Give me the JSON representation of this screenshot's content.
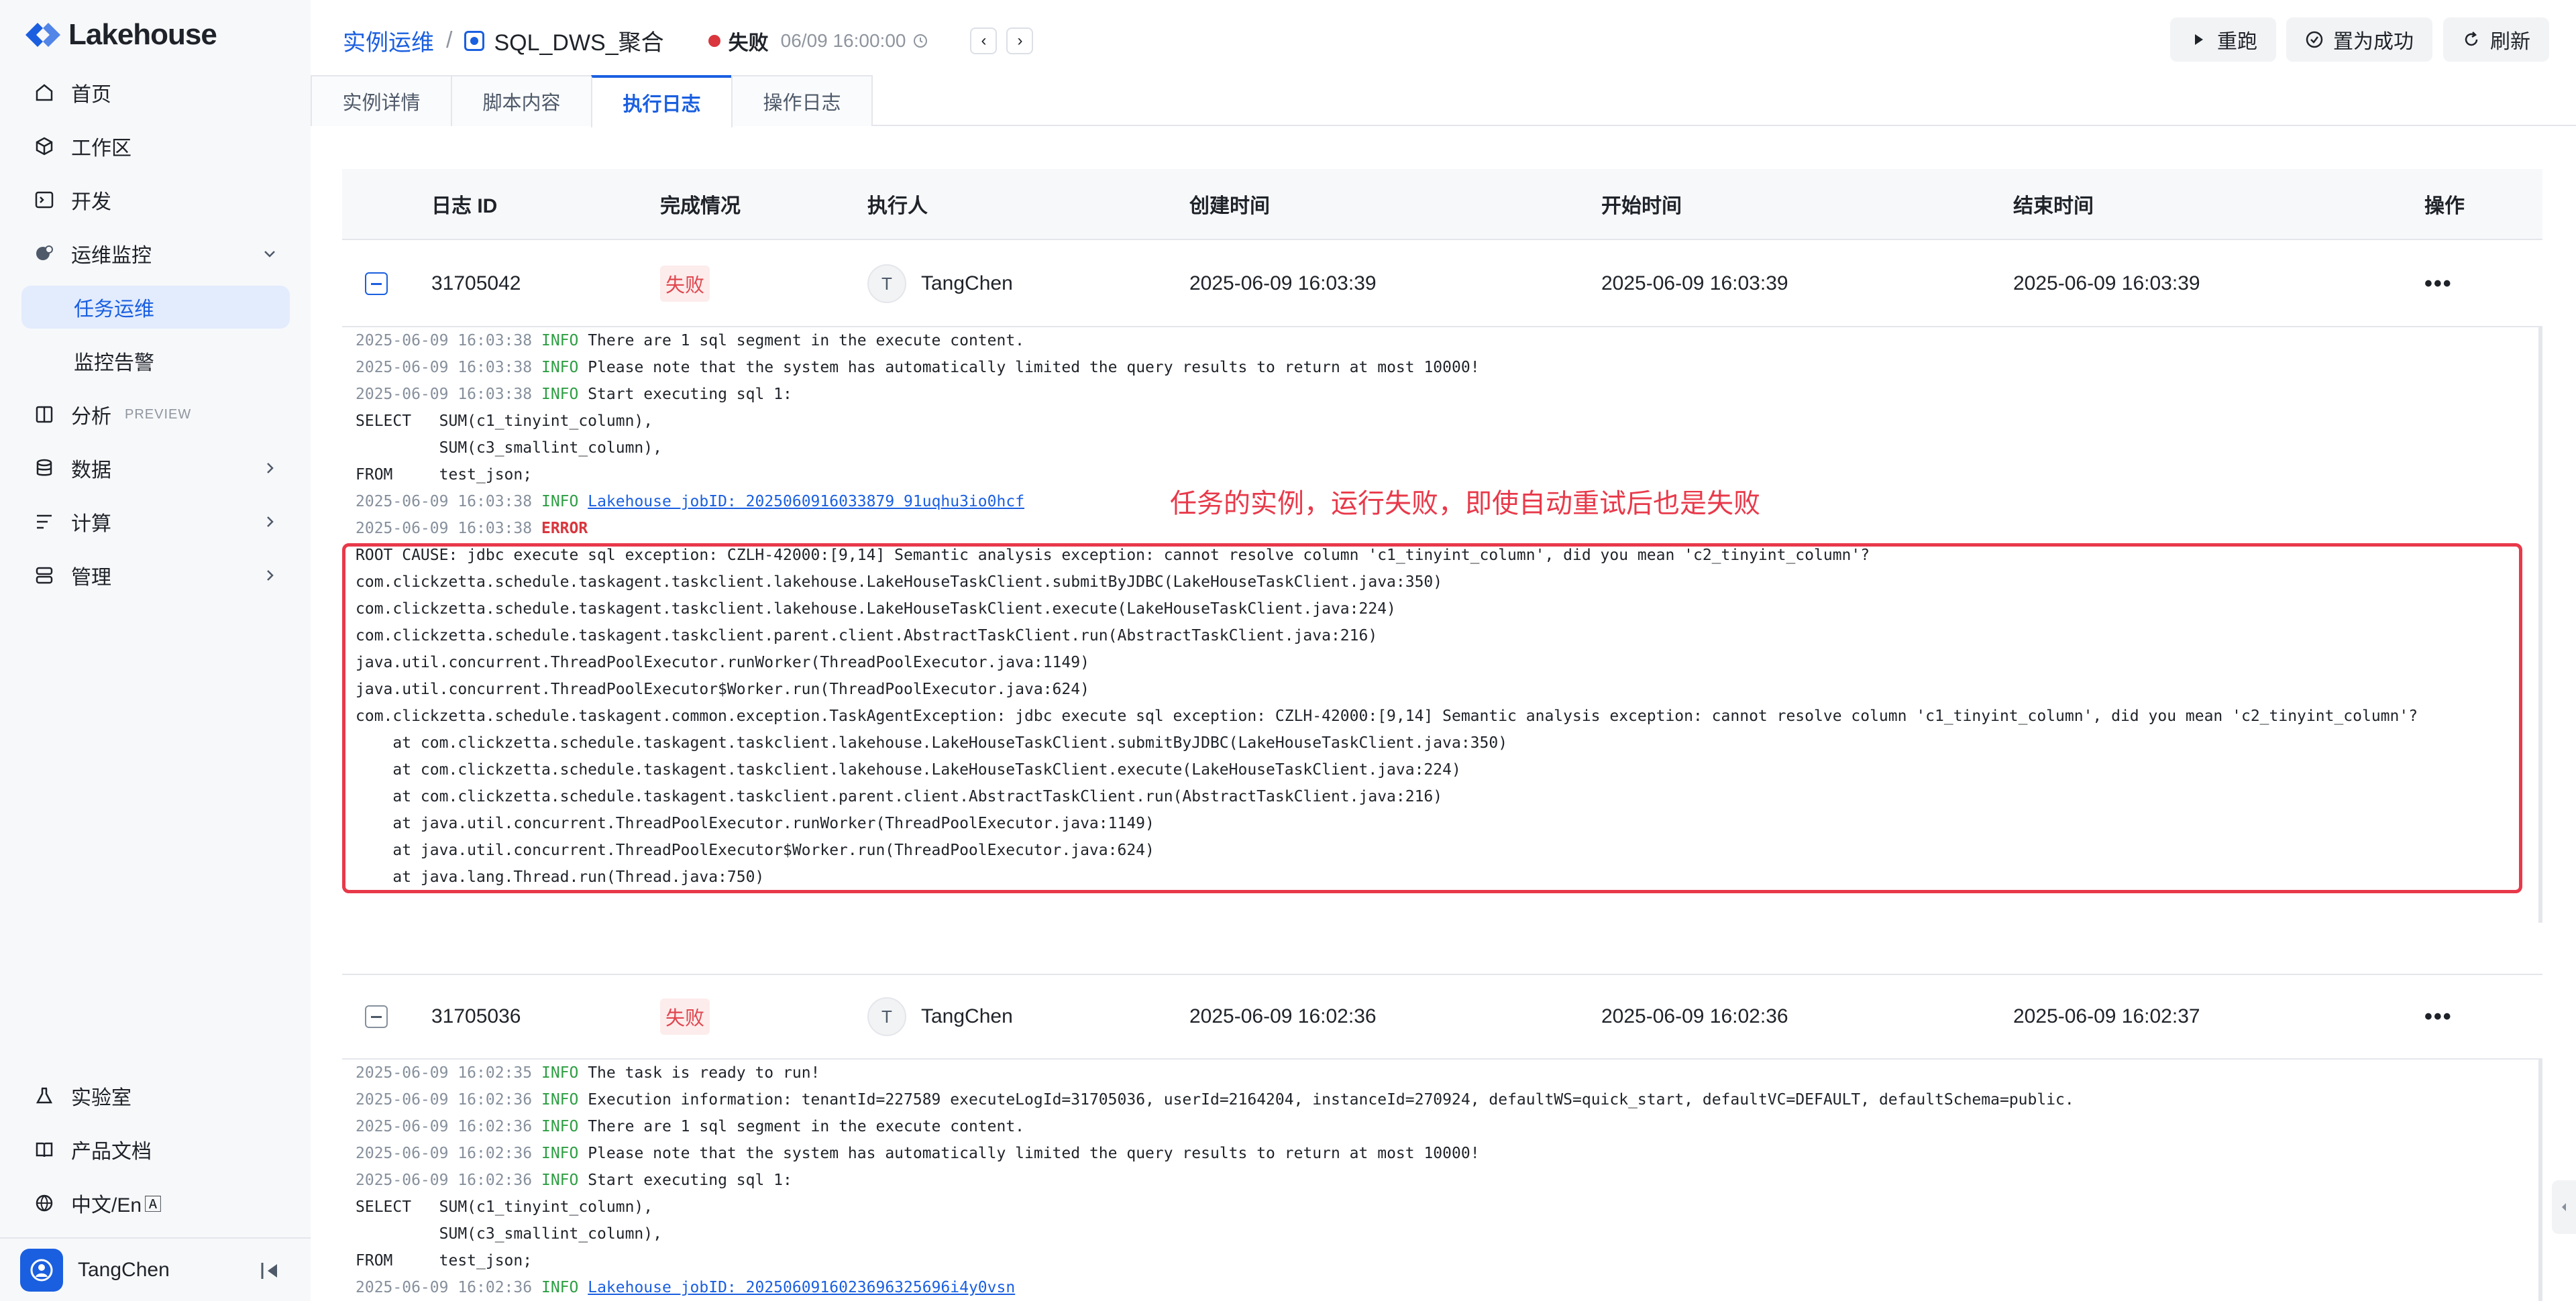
{
  "app": {
    "brand": "Lakehouse",
    "accent": "#1a5fe0",
    "error_color": "#d9363e"
  },
  "sidebar": {
    "items": [
      {
        "label": "首页",
        "icon": "home-icon"
      },
      {
        "label": "工作区",
        "icon": "cube-icon"
      },
      {
        "label": "开发",
        "icon": "terminal-icon"
      },
      {
        "label": "运维监控",
        "icon": "monitor-icon",
        "expanded": true
      },
      {
        "label": "任务运维",
        "active": true
      },
      {
        "label": "监控告警"
      },
      {
        "label": "分析",
        "icon": "book-icon",
        "badge": "PREVIEW"
      },
      {
        "label": "数据",
        "icon": "database-icon"
      },
      {
        "label": "计算",
        "icon": "compute-icon"
      },
      {
        "label": "管理",
        "icon": "manage-icon"
      }
    ],
    "bottom": [
      {
        "label": "实验室",
        "icon": "flask-icon"
      },
      {
        "label": "产品文档",
        "icon": "doc-icon"
      },
      {
        "label": "中文/En",
        "icon": "globe-icon"
      }
    ],
    "user": "TangChen"
  },
  "header": {
    "breadcrumb_root": "实例运维",
    "separator": "/",
    "task_name": "SQL_DWS_聚合",
    "status": "失败",
    "run_time": "06/09 16:00:00",
    "prev": "‹",
    "next": "›",
    "actions": {
      "rerun": "重跑",
      "set_success": "置为成功",
      "refresh": "刷新"
    }
  },
  "tabs": [
    "实例详情",
    "脚本内容",
    "执行日志",
    "操作日志"
  ],
  "table": {
    "headers": [
      "日志 ID",
      "完成情况",
      "执行人",
      "创建时间",
      "开始时间",
      "结束时间",
      "操作"
    ],
    "rows": [
      {
        "id": "31705042",
        "status": "失败",
        "avatar": "T",
        "user": "TangChen",
        "created": "2025-06-09 16:03:39",
        "started": "2025-06-09 16:03:39",
        "ended": "2025-06-09 16:03:39",
        "more": "•••"
      },
      {
        "id": "31705036",
        "status": "失败",
        "avatar": "T",
        "user": "TangChen",
        "created": "2025-06-09 16:02:36",
        "started": "2025-06-09 16:02:36",
        "ended": "2025-06-09 16:02:37",
        "more": "•••"
      }
    ]
  },
  "annotation": "任务的实例，运行失败，即使自动重试后也是失败",
  "log1": [
    {
      "ts": "2025-06-09 16:03:38",
      "level": "INFO",
      "msg": " There are 1 sql segment in the execute content."
    },
    {
      "ts": "2025-06-09 16:03:38",
      "level": "INFO",
      "msg": " Please note that the system has automatically limited the query results to return at most 10000!"
    },
    {
      "ts": "2025-06-09 16:03:38",
      "level": "INFO",
      "msg": " Start executing sql 1:"
    },
    {
      "text": "SELECT   SUM(c1_tinyint_column),"
    },
    {
      "text": "         SUM(c3_smallint_column),"
    },
    {
      "text": "FROM     test_json;"
    },
    {
      "ts": "2025-06-09 16:03:38",
      "level": "INFO",
      "link": "Lakehouse jobID: 2025060916033879 91uqhu3io0hcf"
    },
    {
      "ts": "2025-06-09 16:03:38",
      "level": "ERROR",
      "msg": ""
    },
    {
      "text": "ROOT CAUSE: jdbc execute sql exception: CZLH-42000:[9,14] Semantic analysis exception: cannot resolve column 'c1_tinyint_column', did you mean 'c2_tinyint_column'?"
    },
    {
      "text": "com.clickzetta.schedule.taskagent.taskclient.lakehouse.LakeHouseTaskClient.submitByJDBC(LakeHouseTaskClient.java:350)"
    },
    {
      "text": "com.clickzetta.schedule.taskagent.taskclient.lakehouse.LakeHouseTaskClient.execute(LakeHouseTaskClient.java:224)"
    },
    {
      "text": "com.clickzetta.schedule.taskagent.taskclient.parent.client.AbstractTaskClient.run(AbstractTaskClient.java:216)"
    },
    {
      "text": "java.util.concurrent.ThreadPoolExecutor.runWorker(ThreadPoolExecutor.java:1149)"
    },
    {
      "text": "java.util.concurrent.ThreadPoolExecutor$Worker.run(ThreadPoolExecutor.java:624)"
    },
    {
      "text": "com.clickzetta.schedule.taskagent.common.exception.TaskAgentException: jdbc execute sql exception: CZLH-42000:[9,14] Semantic analysis exception: cannot resolve column 'c1_tinyint_column', did you mean 'c2_tinyint_column'?"
    },
    {
      "text": "    at com.clickzetta.schedule.taskagent.taskclient.lakehouse.LakeHouseTaskClient.submitByJDBC(LakeHouseTaskClient.java:350)"
    },
    {
      "text": "    at com.clickzetta.schedule.taskagent.taskclient.lakehouse.LakeHouseTaskClient.execute(LakeHouseTaskClient.java:224)"
    },
    {
      "text": "    at com.clickzetta.schedule.taskagent.taskclient.parent.client.AbstractTaskClient.run(AbstractTaskClient.java:216)"
    },
    {
      "text": "    at java.util.concurrent.ThreadPoolExecutor.runWorker(ThreadPoolExecutor.java:1149)"
    },
    {
      "text": "    at java.util.concurrent.ThreadPoolExecutor$Worker.run(ThreadPoolExecutor.java:624)"
    },
    {
      "text": "    at java.lang.Thread.run(Thread.java:750)"
    }
  ],
  "log2": [
    {
      "ts": "2025-06-09 16:02:35",
      "level": "INFO",
      "msg": " The task is ready to run!"
    },
    {
      "ts": "2025-06-09 16:02:36",
      "level": "INFO",
      "msg": " Execution information: tenantId=227589 executeLogId=31705036, userId=2164204, instanceId=270924, defaultWS=quick_start, defaultVC=DEFAULT, defaultSchema=public."
    },
    {
      "ts": "2025-06-09 16:02:36",
      "level": "INFO",
      "msg": " There are 1 sql segment in the execute content."
    },
    {
      "ts": "2025-06-09 16:02:36",
      "level": "INFO",
      "msg": " Please note that the system has automatically limited the query results to return at most 10000!"
    },
    {
      "ts": "2025-06-09 16:02:36",
      "level": "INFO",
      "msg": " Start executing sql 1:"
    },
    {
      "text": "SELECT   SUM(c1_tinyint_column),"
    },
    {
      "text": "         SUM(c3_smallint_column),"
    },
    {
      "text": "FROM     test_json;"
    },
    {
      "ts": "2025-06-09 16:02:36",
      "level": "INFO",
      "link": "Lakehouse jobID: 2025060916023696325696i4y0vsn"
    }
  ]
}
